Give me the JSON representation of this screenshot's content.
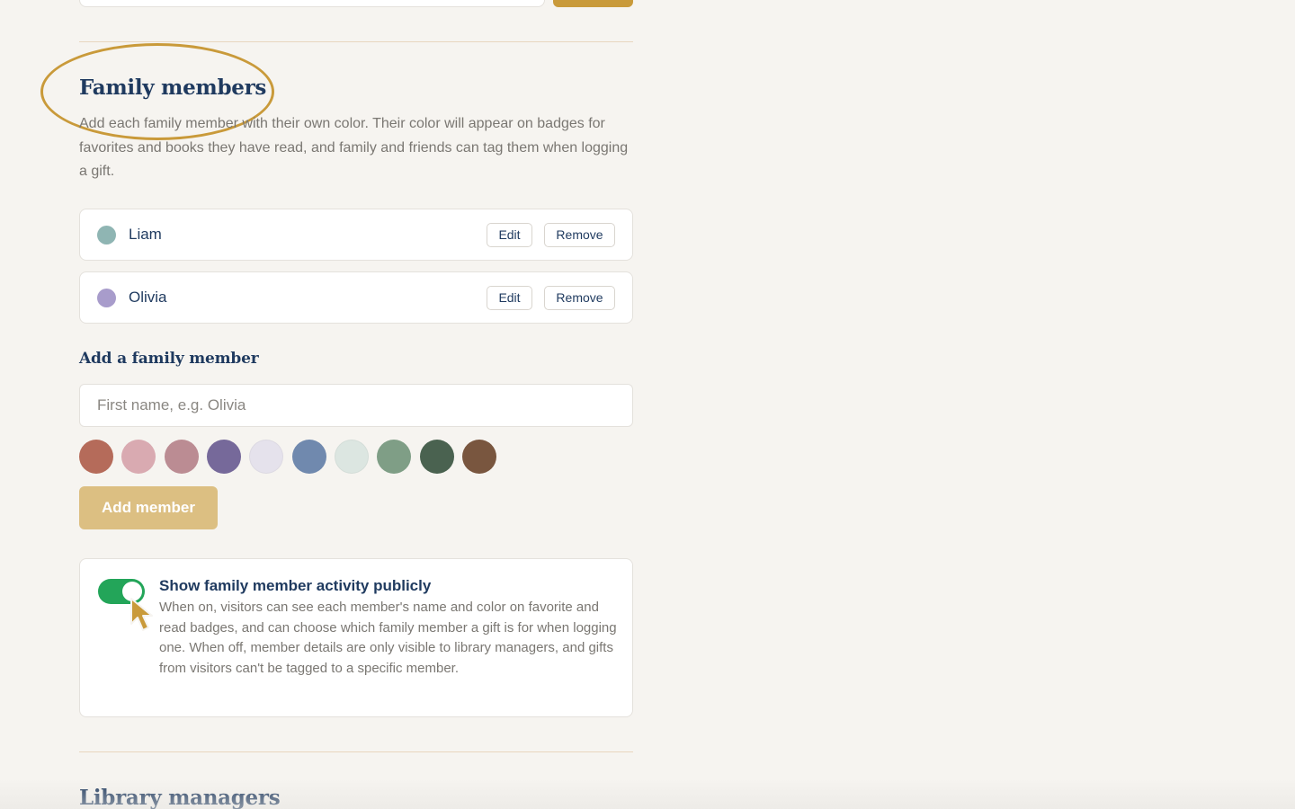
{
  "section": {
    "title": "Family members",
    "description": "Add each family member with their own color. Their color will appear on badges for favorites and books they have read, and family and friends can tag them when logging a gift."
  },
  "members": [
    {
      "name": "Liam",
      "color": "#8fb5b3",
      "edit_label": "Edit",
      "remove_label": "Remove"
    },
    {
      "name": "Olivia",
      "color": "#a89ccb",
      "edit_label": "Edit",
      "remove_label": "Remove"
    }
  ],
  "add_member": {
    "title": "Add a family member",
    "name_placeholder": "First name, e.g. Olivia",
    "name_value": "",
    "colors": [
      "#b56b5a",
      "#d9aab1",
      "#bb8c93",
      "#76699a",
      "#e5e2ec",
      "#7089ae",
      "#dce6e1",
      "#7f9e86",
      "#4a6250",
      "#79563f"
    ],
    "button_label": "Add member"
  },
  "visibility": {
    "enabled": true,
    "title": "Show family member activity publicly",
    "description": "When on, visitors can see each member's name and color on favorite and read badges, and can choose which family member a gift is for when logging one. When off, member details are only visible to library managers, and gifts from visitors can't be tagged to a specific member."
  },
  "next_section": {
    "title": "Library managers"
  },
  "theme": {
    "accent": "#c99a3a",
    "toggle_on": "#23a559",
    "heading": "#1f3a5f"
  }
}
